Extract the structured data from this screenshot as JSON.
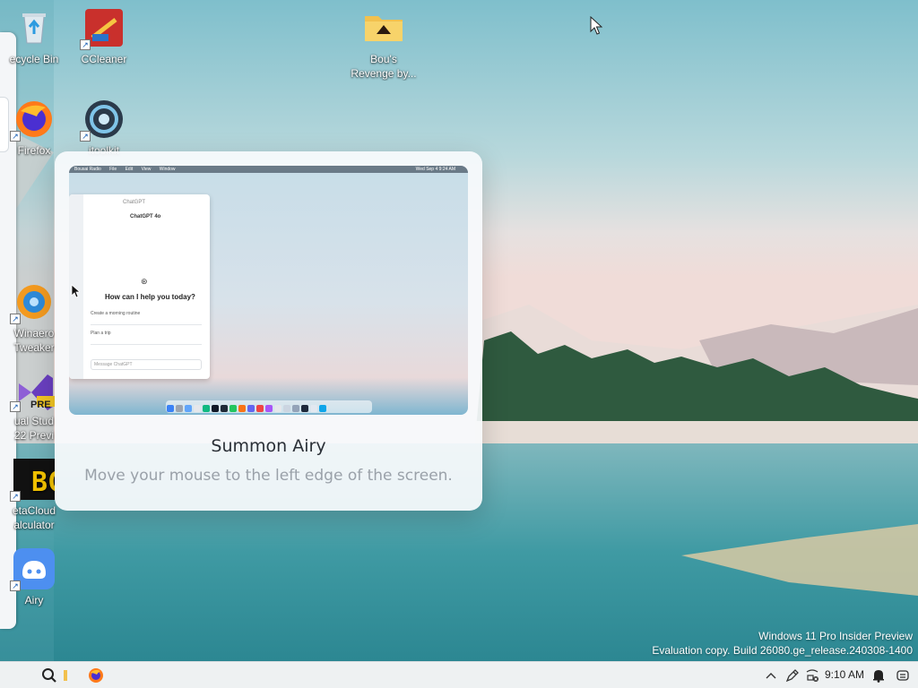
{
  "desktop": {
    "icons": [
      {
        "id": "recycle-bin",
        "label": "ecycle Bin",
        "label2": ""
      },
      {
        "id": "ccleaner",
        "label": "CCleaner",
        "label2": ""
      },
      {
        "id": "bous-revenge",
        "label": "Bou's",
        "label2": "Revenge by..."
      },
      {
        "id": "firefox",
        "label": "Firefox",
        "label2": ""
      },
      {
        "id": "itoolkit",
        "label": "itoolkit",
        "label2": ""
      },
      {
        "id": "winaero",
        "label": "Winaero",
        "label2": "Tweaker"
      },
      {
        "id": "visual-studio",
        "label": "ual Stud",
        "label2": "22 Previ"
      },
      {
        "id": "betacloud",
        "label": "etaCloud",
        "label2": "alculator"
      },
      {
        "id": "airy",
        "label": "Airy",
        "label2": ""
      }
    ],
    "vs_badge": "PRE"
  },
  "tip_card": {
    "title": "Summon Airy",
    "body": "Move your mouse to the left edge of the screen.",
    "preview": {
      "menubar": [
        "Bousai Radio",
        "File",
        "Edit",
        "View",
        "Window"
      ],
      "menubar_right": "Wed Sep 4 9:24 AM",
      "window_title": "ChatGPT",
      "model_label": "ChatGPT 4o",
      "prompt_heading": "How can I help you today?",
      "suggestions": [
        "Create a morning routine",
        "Plan a trip"
      ],
      "message_placeholder": "Message ChatGPT"
    }
  },
  "watermark": {
    "line1": "Windows 11 Pro Insider Preview",
    "line2": "Evaluation copy. Build 26080.ge_release.240308-1400"
  },
  "taskbar": {
    "time": "9:10 AM",
    "icons": [
      "search-icon",
      "file-explorer-icon",
      "firefox-icon",
      "chevron-up-icon",
      "pen-icon",
      "network-icon",
      "bell-icon",
      "copilot-icon"
    ]
  }
}
